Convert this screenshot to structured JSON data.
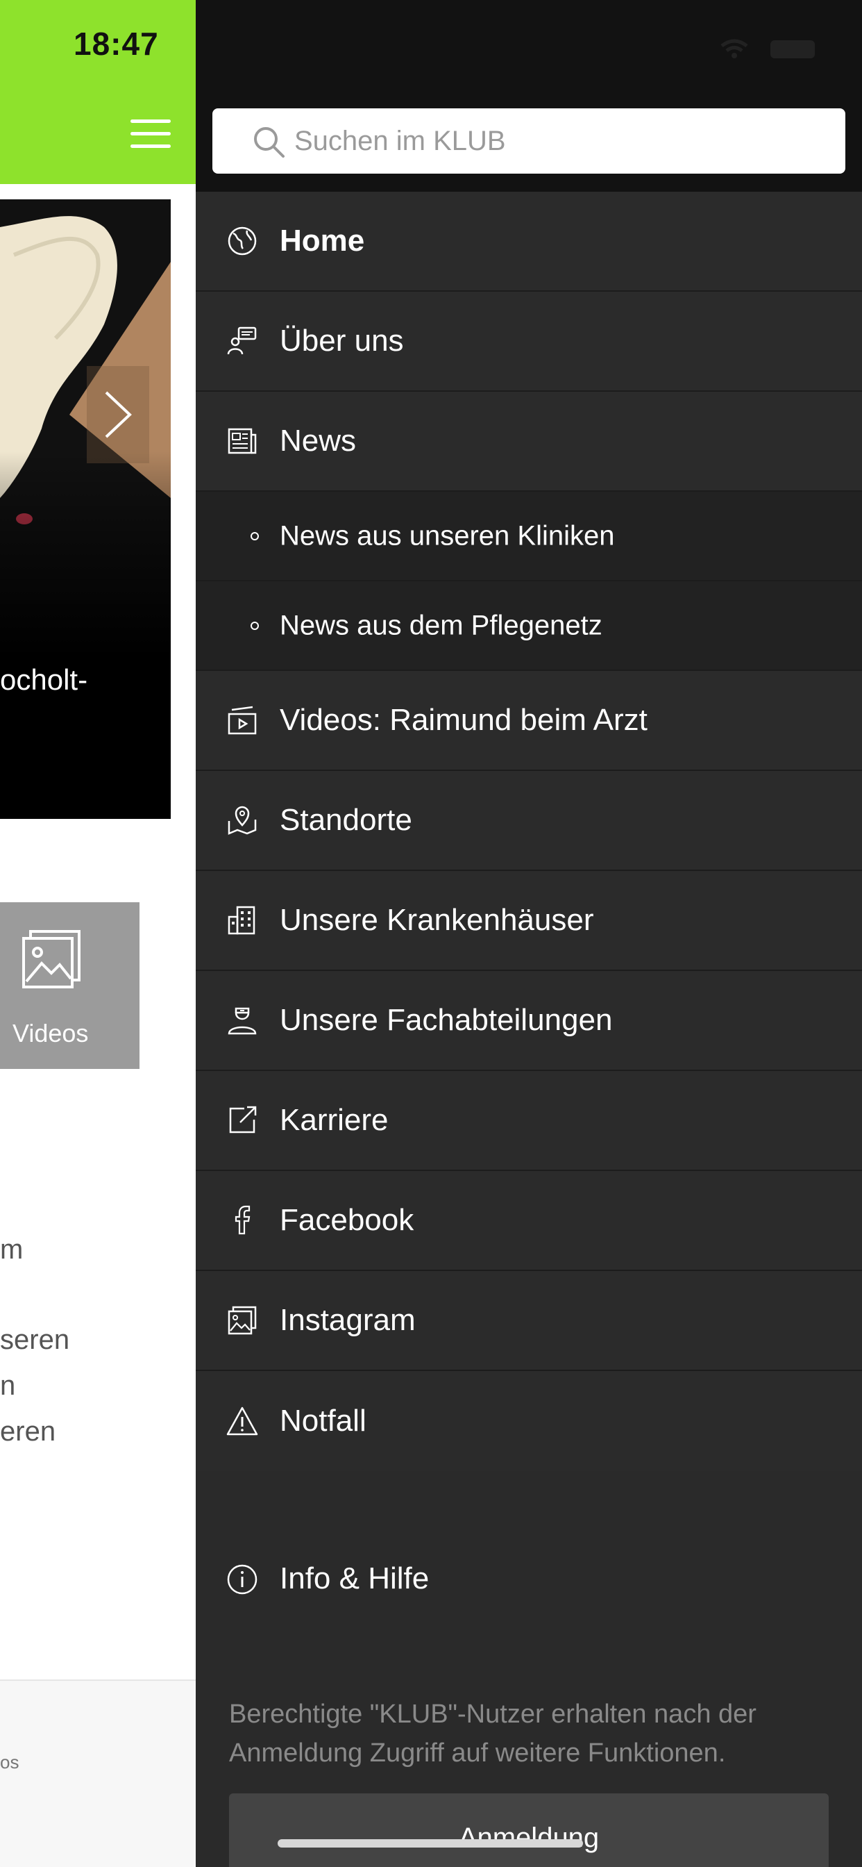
{
  "status_bar": {
    "time": "18:47"
  },
  "left_page": {
    "hero_caption": "ocholt-",
    "videos_tile_label": "Videos",
    "text_fragments": [
      "m",
      "seren",
      "n",
      "eren"
    ],
    "bottom_tab_fragment": "os"
  },
  "search": {
    "placeholder": "Suchen im KLUB",
    "value": ""
  },
  "menu": {
    "items": [
      {
        "label": "Home",
        "icon": "globe-icon",
        "active": true
      },
      {
        "label": "Über uns",
        "icon": "chat-people-icon"
      },
      {
        "label": "News",
        "icon": "newspaper-icon"
      },
      {
        "label": "News aus unseren Kliniken",
        "icon": "bullet",
        "sub": true
      },
      {
        "label": "News aus dem Pflegenetz",
        "icon": "bullet",
        "sub": true
      },
      {
        "label": "Videos: Raimund beim Arzt",
        "icon": "video-icon"
      },
      {
        "label": "Standorte",
        "icon": "map-pin-icon"
      },
      {
        "label": "Unsere Krankenhäuser",
        "icon": "building-icon"
      },
      {
        "label": "Unsere Fachabteilungen",
        "icon": "doctor-icon"
      },
      {
        "label": "Karriere",
        "icon": "external-link-icon"
      },
      {
        "label": "Facebook",
        "icon": "facebook-icon"
      },
      {
        "label": "Instagram",
        "icon": "gallery-icon"
      },
      {
        "label": "Notfall",
        "icon": "warning-icon"
      }
    ],
    "info_label": "Info & Hilfe",
    "login_note": "Berechtigte \"KLUB\"-Nutzer erhalten nach der Anmeldung Zugriff auf weitere Funktionen.",
    "login_button": "Anmeldung"
  },
  "colors": {
    "header_green": "#8ee22c",
    "menu_bg": "#2b2b2b",
    "submenu_bg": "#222222",
    "topbar_bg": "#121212"
  }
}
